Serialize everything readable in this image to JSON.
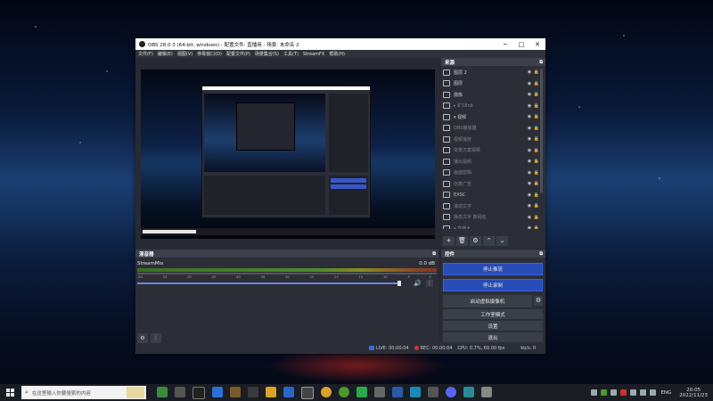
{
  "window": {
    "title": "OBS 28.0.3 (64-bit, windows) - 配置文件: 直播用 - 场景: 未命名 2",
    "controls": [
      "─",
      "□",
      "✕"
    ]
  },
  "menu": [
    "文件(F)",
    "编辑(E)",
    "视图(V)",
    "停靠窗口(D)",
    "配置文件(P)",
    "场景集合(S)",
    "工具(T)",
    "StreamFX",
    "帮助(H)"
  ],
  "sources": {
    "title": "来源",
    "items": [
      {
        "name": "图层 2",
        "dim": false
      },
      {
        "name": "图层",
        "dim": false
      },
      {
        "name": "摄像",
        "dim": false
      },
      {
        "name": "▸ 矿18nb",
        "dim": true
      },
      {
        "name": "▾ 视频",
        "dim": false
      },
      {
        "name": "OBS播放器",
        "dim": true
      },
      {
        "name": "视频播放",
        "dim": true
      },
      {
        "name": "背景方案视频",
        "dim": true
      },
      {
        "name": "播出视频",
        "dim": true
      },
      {
        "name": "画面剪辑",
        "dim": true
      },
      {
        "name": "创意广告",
        "dim": true
      },
      {
        "name": "EXSC",
        "dim": false
      },
      {
        "name": "滚动文字",
        "dim": true
      },
      {
        "name": "静态文字 数码包",
        "dim": true
      },
      {
        "name": "▾ 直播大",
        "dim": true
      }
    ],
    "tools": [
      "+",
      "🗑",
      "⚙",
      "⌃",
      "⌄"
    ]
  },
  "mixer": {
    "title": "混音器",
    "track_name": "StreamMix",
    "db_value": "0.0 dB",
    "ticks": [
      "-60",
      "-55",
      "-50",
      "-45",
      "-40",
      "-35",
      "-30",
      "-25",
      "-20",
      "-15",
      "-10",
      "-5",
      "0"
    ],
    "volume_level": 0.96
  },
  "controls": {
    "title": "控件",
    "stop_stream": "停止推流",
    "stop_record": "停止录制",
    "virtual_cam": "启动虚拟摄像机",
    "studio_mode": "工作室模式",
    "settings": "设置",
    "exit": "退出"
  },
  "status": {
    "live": "LIVE: 00:00:04",
    "rec": "REC: 00:00:04",
    "cpu": "CPU: 0.7%, 60.00 fps",
    "rate": "kb/s: 0"
  },
  "taskbar": {
    "search_placeholder": "在这里输入你要搜索的内容",
    "lang": "ENG",
    "time": "20:05",
    "date": "2022/11/23"
  }
}
